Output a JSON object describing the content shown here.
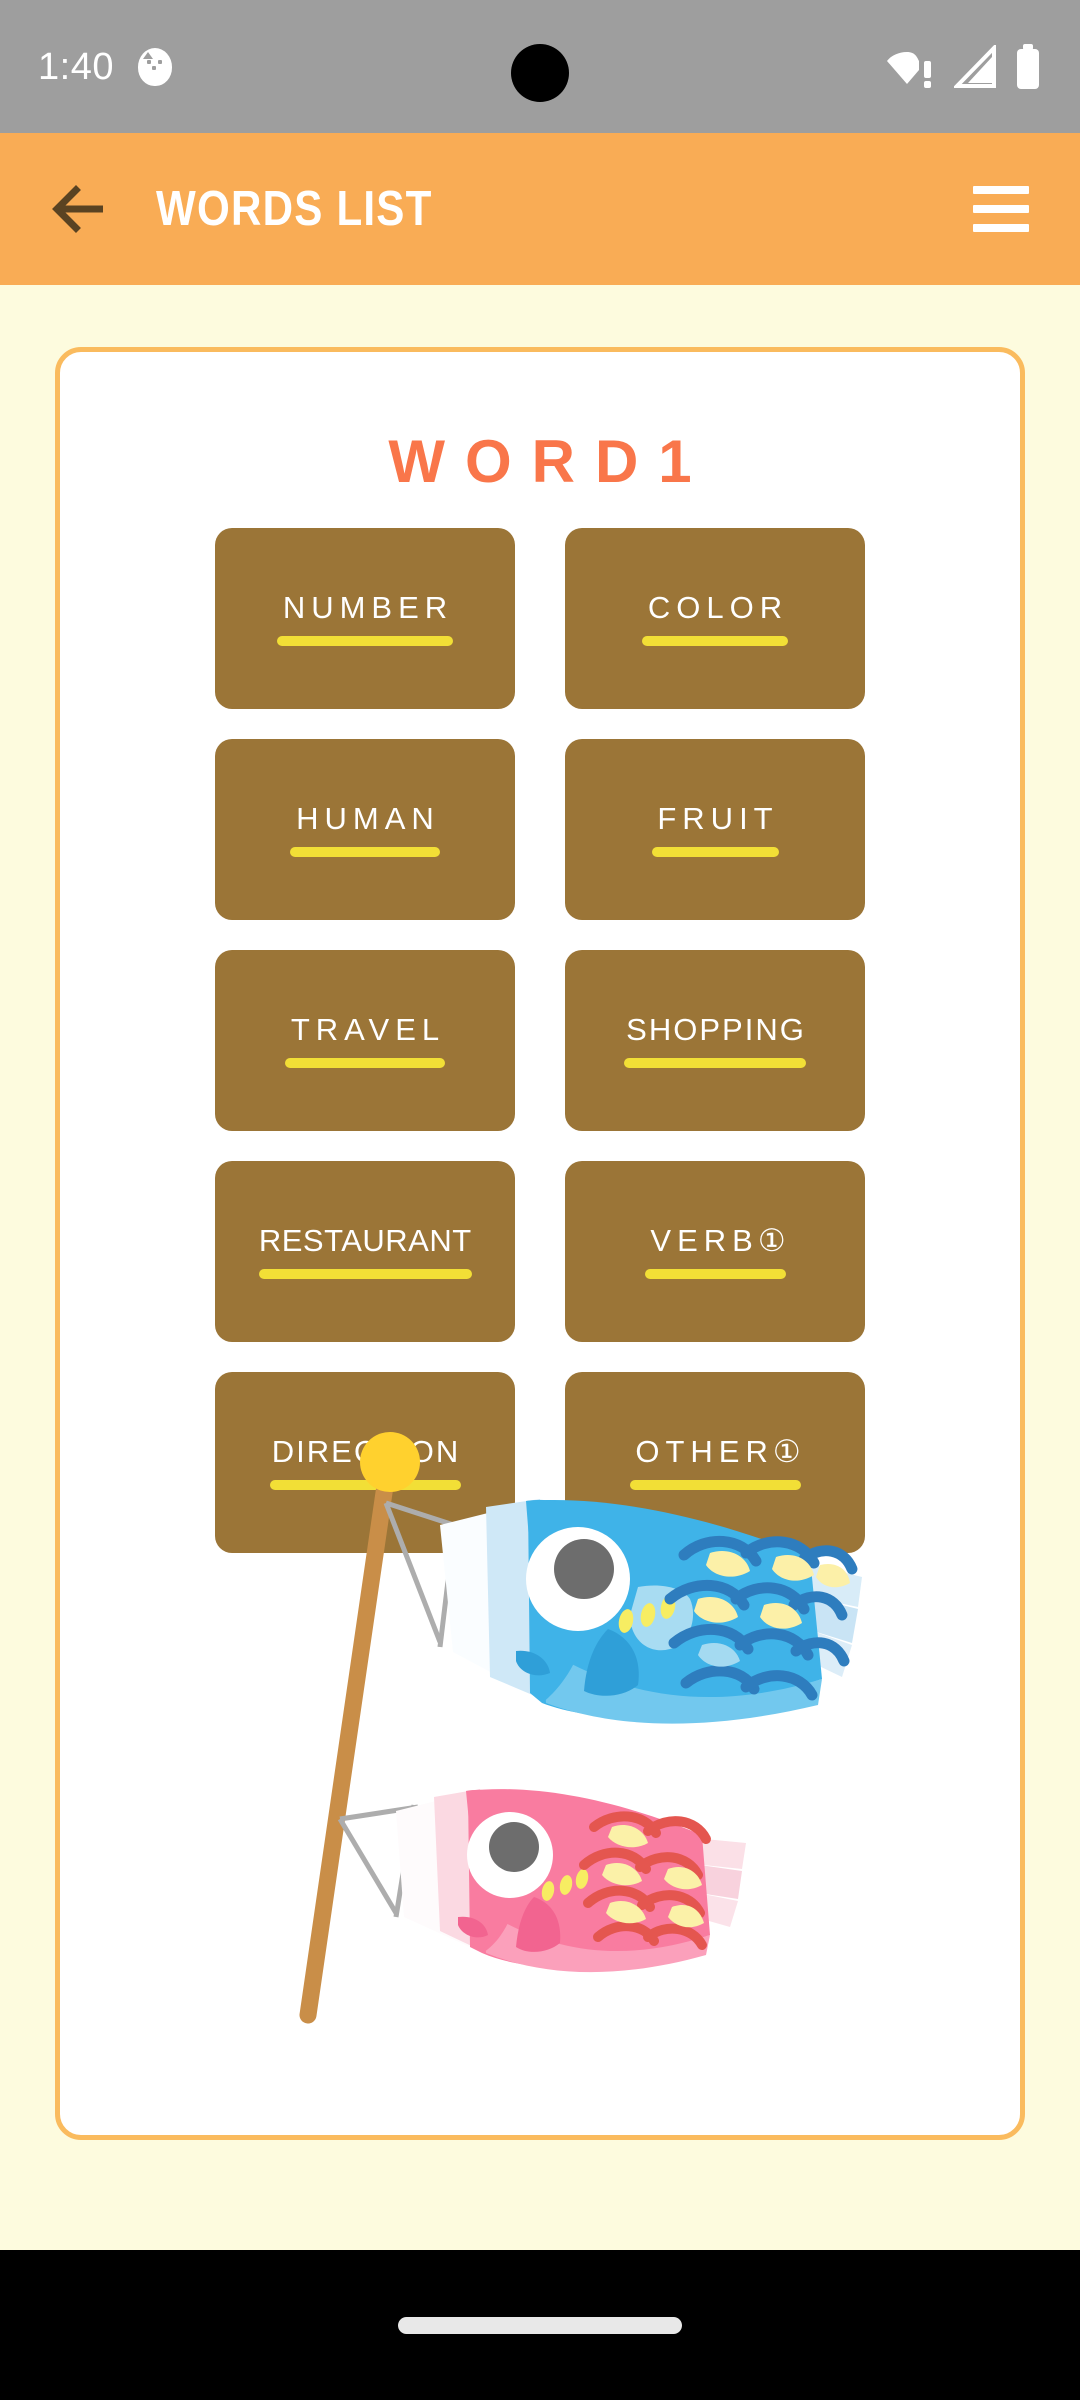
{
  "status_bar": {
    "clock": "1:40",
    "notification_icon": "cat-face-icon",
    "icons": [
      "wifi-warning-icon",
      "cellular-signal-icon",
      "battery-full-icon"
    ]
  },
  "app_bar": {
    "back_icon": "arrow-left-icon",
    "title": "WORDS LIST",
    "menu_icon": "hamburger-menu-icon"
  },
  "card": {
    "title": "WORD1",
    "buttons": [
      {
        "label": "NUMBER",
        "badge": "",
        "spacing": "normal"
      },
      {
        "label": "COLOR",
        "badge": "",
        "spacing": "normal"
      },
      {
        "label": "HUMAN",
        "badge": "",
        "spacing": "normal"
      },
      {
        "label": "FRUIT",
        "badge": "",
        "spacing": "normal"
      },
      {
        "label": "TRAVEL",
        "badge": "",
        "spacing": "normal"
      },
      {
        "label": "SHOPPING",
        "badge": "",
        "spacing": "tight"
      },
      {
        "label": "RESTAURANT",
        "badge": "",
        "spacing": "xtight"
      },
      {
        "label": "VERB",
        "badge": "①",
        "spacing": "normal"
      },
      {
        "label": "DIRECTION",
        "badge": "",
        "spacing": "tight"
      },
      {
        "label": "OTHER",
        "badge": "①",
        "spacing": "normal"
      }
    ],
    "illustration": "koinobori-carp-streamers"
  },
  "nav_bar": {
    "gesture_pill": "home-gesture-pill"
  },
  "colors": {
    "status_bar_bg": "#9E9E9E",
    "app_bar_bg": "#F9AC55",
    "page_bg": "#FDFBDE",
    "card_bg": "#FFFFFF",
    "card_border": "#FABB5E",
    "card_title": "#F9764A",
    "button_bg": "#9B7537",
    "button_text": "#FFFFFF",
    "button_underline": "#F2DF36",
    "back_arrow": "#5A4322",
    "nav_bar_bg": "#000000",
    "fish_blue": "#3FB3E8",
    "fish_blue_dark": "#2E8FCB",
    "fish_blue_light": "#BFE4F7",
    "fish_pink": "#F97CA0",
    "fish_pink_dark": "#E55B6F",
    "fish_pink_light": "#FBD0DB",
    "pole": "#C98E48",
    "pole_ball": "#FFD12E"
  }
}
